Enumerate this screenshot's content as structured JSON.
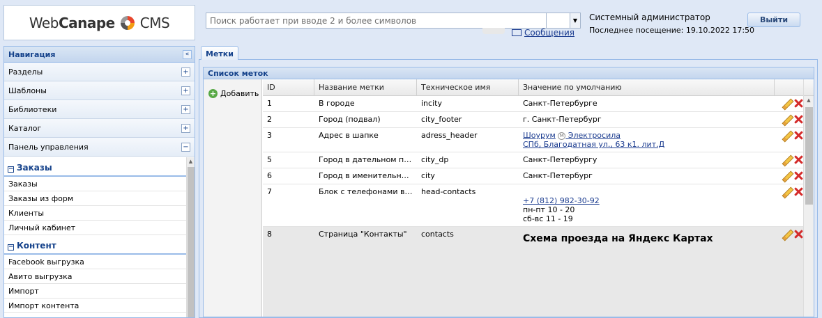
{
  "header": {
    "logo_part1": "Web",
    "logo_part2": "Canape",
    "logo_part3": "CMS",
    "search_placeholder": "Поиск работает при вводе 2 и более символов",
    "messages_link": "Сообщения",
    "user_name": "Системный администратор",
    "last_visit": "Последнее посещение: 19.10.2022 17:50",
    "logout_label": "Выйти"
  },
  "nav": {
    "title": "Навигация",
    "collapse_glyph": "«",
    "sections": [
      {
        "label": "Разделы",
        "toggle": "+"
      },
      {
        "label": "Шаблоны",
        "toggle": "+"
      },
      {
        "label": "Библиотеки",
        "toggle": "+"
      },
      {
        "label": "Каталог",
        "toggle": "+"
      },
      {
        "label": "Панель управления",
        "toggle": "−"
      }
    ],
    "groups": [
      {
        "title": "Заказы",
        "items": [
          "Заказы",
          "Заказы из форм",
          "Клиенты",
          "Личный кабинет"
        ]
      },
      {
        "title": "Контент",
        "items": [
          "Facebook выгрузка",
          "Авито выгрузка",
          "Импорт",
          "Импорт контента"
        ]
      }
    ]
  },
  "main": {
    "tab_label": "Метки",
    "panel_title": "Список меток",
    "add_label": "Добавить",
    "columns": [
      "ID",
      "Название метки",
      "Техническое имя",
      "Значение по умолчанию"
    ],
    "rows": [
      {
        "id": "1",
        "name": "В городе",
        "tech": "incity",
        "value": "Санкт-Петербурге"
      },
      {
        "id": "2",
        "name": "Город (подвал)",
        "tech": "city_footer",
        "value": "г. Санкт-Петербург"
      },
      {
        "id": "3",
        "name": "Адрес в шапке",
        "tech": "adress_header",
        "value_link1": "Шоурум",
        "value_metro": "М",
        "value_link2": " Электросила",
        "value_link3": "СПб, Благодатная ул., 63 к1. лит.Д"
      },
      {
        "id": "5",
        "name": "Город в дательном паде...",
        "tech": "city_dp",
        "value": "Санкт-Петербургу"
      },
      {
        "id": "6",
        "name": "Город в именительном п...",
        "tech": "city",
        "value": "Санкт-Петербург"
      },
      {
        "id": "7",
        "name": "Блок с телефонами в ша...",
        "tech": "head-contacts",
        "value_phone": "+7 (812) 982-30-92",
        "value_line2": "пн-пт 10 - 20",
        "value_line3": "сб-вс 11 - 19"
      },
      {
        "id": "8",
        "name": "Страница \"Контакты\"",
        "tech": "contacts",
        "value_big": "Схема проезда на Яндекс Картах"
      }
    ]
  }
}
